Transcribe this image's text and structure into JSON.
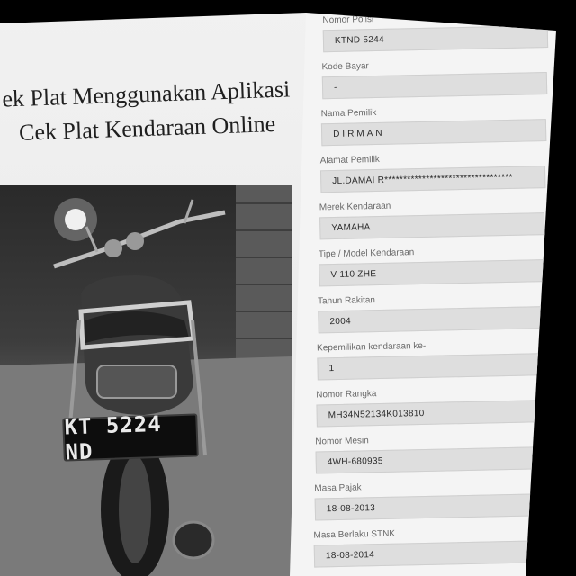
{
  "article": {
    "headline_line1": "ek Plat Menggunakan Aplikasi",
    "headline_line2": "Cek Plat Kendaraan Online",
    "plate_text": "KT 5224 ND"
  },
  "form": {
    "fields": [
      {
        "label": "Nomor Polisi",
        "value": "KTND 5244"
      },
      {
        "label": "Kode Bayar",
        "value": "-"
      },
      {
        "label": "Nama Pemilik",
        "value": "DIRMAN"
      },
      {
        "label": "Alamat Pemilik",
        "value": "JL.DAMAI R**********************************"
      },
      {
        "label": "Merek Kendaraan",
        "value": "YAMAHA"
      },
      {
        "label": "Tipe / Model Kendaraan",
        "value": "V 110 ZHE"
      },
      {
        "label": "Tahun Rakitan",
        "value": "2004"
      },
      {
        "label": "Kepemilikan kendaraan ke-",
        "value": "1"
      },
      {
        "label": "Nomor Rangka",
        "value": "MH34N52134K013810"
      },
      {
        "label": "Nomor Mesin",
        "value": "4WH-680935"
      },
      {
        "label": "Masa Pajak",
        "value": "18-08-2013"
      },
      {
        "label": "Masa Berlaku STNK",
        "value": "18-08-2014"
      }
    ]
  }
}
